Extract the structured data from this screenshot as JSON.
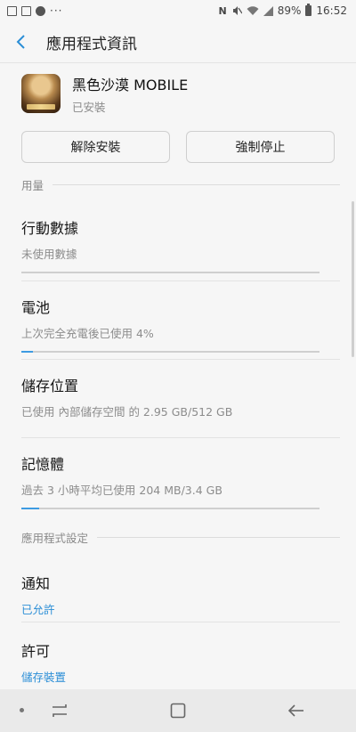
{
  "status_bar": {
    "battery_percent": "89%",
    "time": "16:52",
    "left_icons": [
      "image-icon",
      "mail-icon",
      "info-icon",
      "more-dots-icon"
    ],
    "right_icons": [
      "nfc-icon",
      "mute-icon",
      "wifi-icon",
      "signal-icon",
      "battery-icon"
    ]
  },
  "app_bar": {
    "title": "應用程式資訊"
  },
  "app": {
    "name": "黑色沙漠 MOBILE",
    "status": "已安裝"
  },
  "buttons": {
    "uninstall": "解除安裝",
    "force_stop": "強制停止"
  },
  "usage_section": {
    "title": "用量"
  },
  "usage_items": [
    {
      "title": "行動數據",
      "subtitle": "未使用數據",
      "progress": 0
    },
    {
      "title": "電池",
      "subtitle": "上次完全充電後已使用 4%",
      "progress": 0.04
    },
    {
      "title": "儲存位置",
      "subtitle": "已使用 內部儲存空間 的 2.95 GB/512 GB"
    },
    {
      "title": "記憶體",
      "subtitle": "過去 3 小時平均已使用 204 MB/3.4 GB",
      "progress": 0.06
    }
  ],
  "settings_section": {
    "title": "應用程式設定"
  },
  "settings_items": [
    {
      "title": "通知",
      "subtitle": "已允許"
    },
    {
      "title": "許可",
      "subtitle": "儲存裝置"
    }
  ],
  "colors": {
    "accent": "#2b8ed6",
    "background": "#f6f6f6"
  }
}
